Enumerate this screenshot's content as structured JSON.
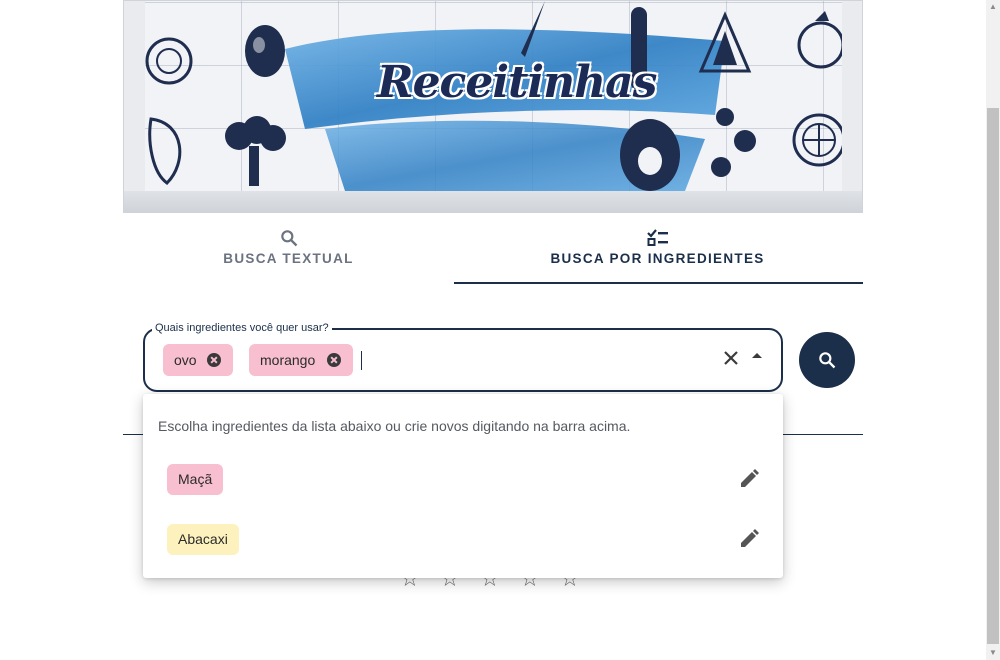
{
  "banner": {
    "title": "Receitinhas"
  },
  "tabs": [
    {
      "label": "BUSCA TEXTUAL",
      "icon": "search-icon",
      "active": false
    },
    {
      "label": "BUSCA POR INGREDIENTES",
      "icon": "checklist-icon",
      "active": true
    }
  ],
  "search": {
    "label": "Quais ingredientes você quer usar?",
    "value": "",
    "chips": [
      {
        "label": "ovo"
      },
      {
        "label": "morango"
      }
    ],
    "chip_color": "#f8bfd0"
  },
  "dropdown": {
    "hint": "Escolha ingredientes da lista abaixo ou crie novos digitando na barra acima.",
    "options": [
      {
        "label": "Maçã",
        "color": "#f8bfd0"
      },
      {
        "label": "Abacaxi",
        "color": "#fdf2bd"
      }
    ]
  },
  "rating": {
    "stars": 5,
    "filled": 0
  },
  "colors": {
    "primary": "#1b2f4a",
    "ribbon": "#3f8fd0"
  }
}
